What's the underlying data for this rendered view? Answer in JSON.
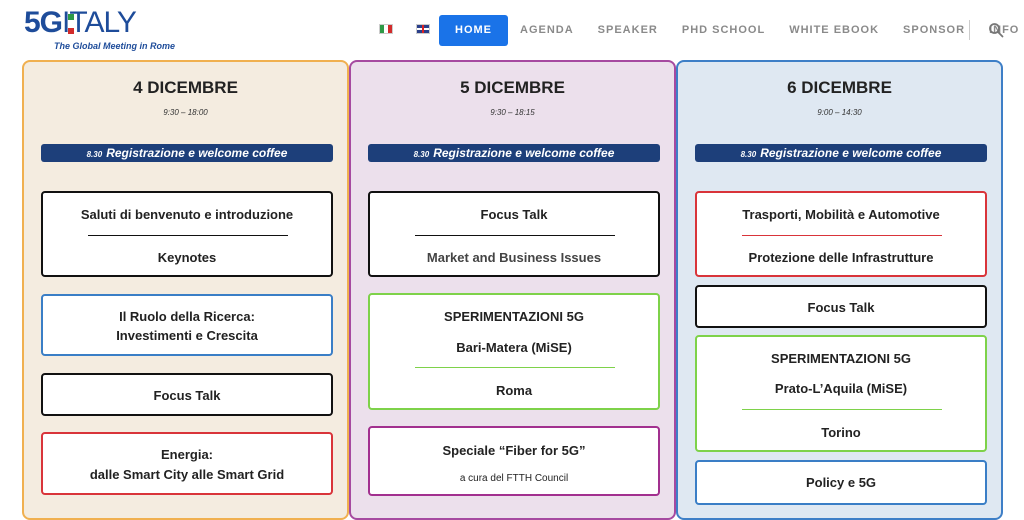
{
  "logo": {
    "five_g": "5G",
    "italy": "ITALY",
    "tagline": "The Global Meeting in Rome"
  },
  "languages": [
    {
      "code": "it",
      "icon": "italy-flag-icon"
    },
    {
      "code": "en",
      "icon": "uk-flag-icon"
    }
  ],
  "nav": {
    "items": [
      {
        "label": "HOME",
        "active": true
      },
      {
        "label": "AGENDA"
      },
      {
        "label": "SPEAKER"
      },
      {
        "label": "PHD SCHOOL"
      },
      {
        "label": "WHITE EBOOK"
      },
      {
        "label": "SPONSOR"
      },
      {
        "label": "INFO"
      }
    ],
    "search_icon": "search-icon"
  },
  "colors": {
    "accent": "#1a73e8",
    "reg_bar": "#1d3f7a",
    "day1_border": "#f0b050",
    "day2_border": "#a64aa0",
    "day3_border": "#3e7fc7"
  },
  "days": [
    {
      "title": "4 DICEMBRE",
      "hours": "9:30 – 18:00",
      "reg_time": "8.30",
      "reg_label": "Registrazione e welcome coffee",
      "sessions": [
        {
          "line1": "Saluti di benvenuto e introduzione",
          "line2": "Keynotes"
        },
        {
          "line1": "Il Ruolo della Ricerca:",
          "line2": "Investimenti e Crescita"
        },
        {
          "line1": "Focus Talk"
        },
        {
          "line1": "Energia:",
          "line2": "dalle Smart City alle Smart Grid"
        }
      ]
    },
    {
      "title": "5 DICEMBRE",
      "hours": "9:30 – 18:15",
      "reg_time": "8.30",
      "reg_label": "Registrazione e welcome coffee",
      "sessions": [
        {
          "line1": "Focus Talk",
          "line2": "Market and Business Issues"
        },
        {
          "line1": "SPERIMENTAZIONI 5G",
          "line2": "Bari-Matera (MiSE)",
          "line3": "Roma"
        },
        {
          "line1": "Speciale “Fiber for 5G”",
          "line2": "a cura del FTTH Council"
        }
      ]
    },
    {
      "title": "6 DICEMBRE",
      "hours": "9:00 – 14:30",
      "reg_time": "8.30",
      "reg_label": "Registrazione e welcome coffee",
      "sessions": [
        {
          "line1": "Trasporti, Mobilità e Automotive",
          "line2": "Protezione delle Infrastrutture"
        },
        {
          "line1": "Focus Talk"
        },
        {
          "line1": "SPERIMENTAZIONI 5G",
          "line2": "Prato-L’Aquila (MiSE)",
          "line3": "Torino"
        },
        {
          "line1": "Policy e 5G"
        }
      ]
    }
  ]
}
